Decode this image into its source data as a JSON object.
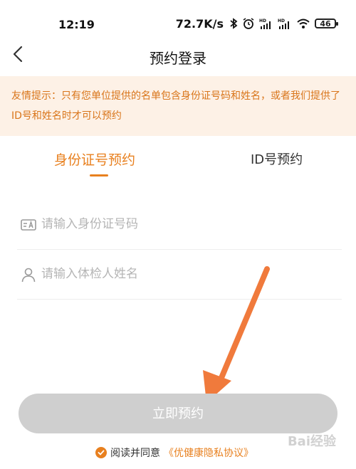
{
  "status_bar": {
    "time": "12:19",
    "speed": "72.7K/s",
    "battery": "46"
  },
  "header": {
    "title": "预约登录"
  },
  "notice": {
    "text": "友情提示：只有您单位提供的名单包含身份证号码和姓名，或者我们提供了ID号和姓名时才可以预约"
  },
  "tabs": [
    {
      "label": "身份证号预约",
      "active": true
    },
    {
      "label": "ID号预约",
      "active": false
    }
  ],
  "form": {
    "id_number_placeholder": "请输入身份证号码",
    "name_placeholder": "请输入体检人姓名"
  },
  "submit": {
    "label": "立即预约"
  },
  "agreement": {
    "prefix": "阅读并同意",
    "link": "《优健康隐私协议》"
  },
  "watermark": "Bai经验",
  "colors": {
    "accent": "#e8801f",
    "notice_bg": "#fdf1e6",
    "disabled_button": "#cfcfcf",
    "arrow": "#f07a3c"
  }
}
